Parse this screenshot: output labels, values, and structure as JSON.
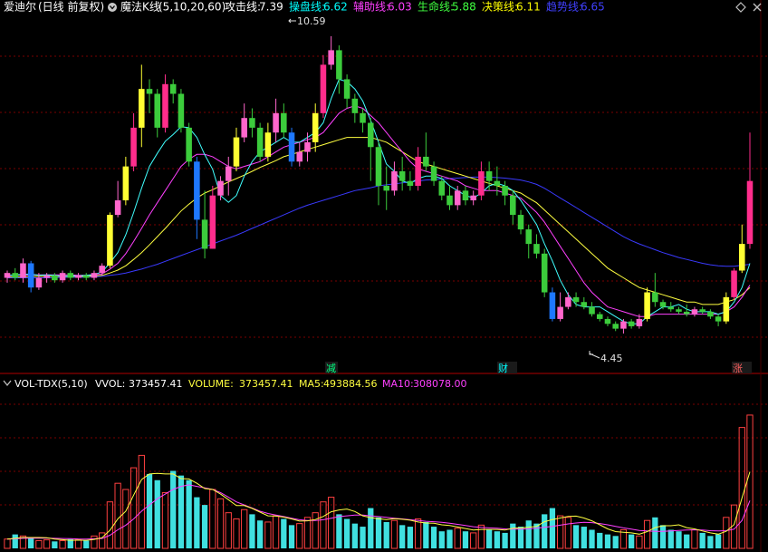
{
  "header": {
    "stock_name": "爱迪尔",
    "period_label": "(日线 前复权)",
    "indicator_name": "魔法K线",
    "indicator_params": "(5,10,20,60)",
    "lines": [
      {
        "label": "攻击线:",
        "value": "7.39",
        "color": "#ffffff"
      },
      {
        "label": "操盘线:",
        "value": "6.62",
        "color": "#00ffff"
      },
      {
        "label": "辅助线:",
        "value": "6.03",
        "color": "#ff40ff"
      },
      {
        "label": "生命线:",
        "value": "5.88",
        "color": "#40ff40"
      },
      {
        "label": "决策线:",
        "value": "6.11",
        "color": "#ffff00"
      },
      {
        "label": "趋势线:",
        "value": "6.65",
        "color": "#4040ff"
      }
    ],
    "corner_icons": [
      "diamond-icon",
      "close-icon"
    ]
  },
  "price_chart": {
    "high_label": "10.59",
    "low_label": "4.45",
    "signals": [
      {
        "text": "减",
        "color": "#00ff80"
      },
      {
        "text": "财",
        "color": "#00ffff"
      },
      {
        "text": "涨",
        "color": "#ff6060"
      }
    ],
    "colors": {
      "up_strong": "#ff2d8c",
      "up_yellow": "#ffff33",
      "down_green": "#3ccc3c",
      "down_blue": "#1e78ff",
      "up_pink": "#ff66cc"
    }
  },
  "volume_panel": {
    "indicator": "VOL-TDX(5,10)",
    "vvol_label": "VVOL:",
    "vvol_value": "373457.41",
    "volume_label": "VOLUME:",
    "volume_value": "373457.41",
    "ma5_label": "MA5:",
    "ma5_value": "493884.56",
    "ma10_label": "MA10:",
    "ma10_value": "308078.00",
    "colors": {
      "up": "#ff4040",
      "down": "#40e0e0",
      "ma5": "#ffff40",
      "ma10": "#ff40ff",
      "vvol": "#ffffff"
    }
  },
  "chart_data": {
    "type": "candlestick",
    "title": "爱迪尔 魔法K线",
    "ylim": [
      4.0,
      11.0
    ],
    "candles": [
      [
        5.6,
        5.7,
        5.5,
        5.75
      ],
      [
        5.7,
        5.6,
        5.55,
        5.8
      ],
      [
        5.6,
        5.9,
        5.5,
        6.0
      ],
      [
        5.9,
        5.4,
        5.3,
        5.95
      ],
      [
        5.4,
        5.6,
        5.35,
        5.7
      ],
      [
        5.6,
        5.65,
        5.5,
        5.7
      ],
      [
        5.65,
        5.55,
        5.5,
        5.7
      ],
      [
        5.55,
        5.7,
        5.5,
        5.75
      ],
      [
        5.7,
        5.6,
        5.55,
        5.75
      ],
      [
        5.6,
        5.65,
        5.55,
        5.7
      ],
      [
        5.65,
        5.6,
        5.55,
        5.7
      ],
      [
        5.6,
        5.7,
        5.55,
        5.75
      ],
      [
        5.7,
        5.85,
        5.65,
        5.9
      ],
      [
        5.85,
        6.9,
        5.8,
        6.95
      ],
      [
        6.9,
        7.2,
        6.85,
        7.6
      ],
      [
        7.2,
        7.9,
        7.1,
        8.1
      ],
      [
        7.9,
        8.7,
        7.8,
        9.0
      ],
      [
        8.7,
        9.5,
        8.3,
        10.0
      ],
      [
        9.5,
        9.4,
        9.0,
        9.7
      ],
      [
        9.4,
        8.7,
        8.5,
        9.5
      ],
      [
        8.7,
        9.6,
        8.6,
        9.8
      ],
      [
        9.6,
        9.4,
        9.2,
        9.7
      ],
      [
        9.4,
        8.7,
        8.6,
        9.5
      ],
      [
        8.7,
        8.0,
        7.9,
        8.8
      ],
      [
        8.0,
        6.8,
        6.4,
        8.1
      ],
      [
        6.8,
        6.2,
        6.0,
        7.4
      ],
      [
        6.2,
        7.3,
        6.2,
        7.5
      ],
      [
        7.3,
        7.6,
        7.2,
        7.7
      ],
      [
        7.6,
        7.9,
        7.3,
        8.1
      ],
      [
        7.9,
        8.5,
        7.8,
        8.7
      ],
      [
        8.5,
        8.9,
        8.4,
        9.2
      ],
      [
        8.9,
        8.7,
        8.5,
        9.1
      ],
      [
        8.7,
        8.1,
        8.0,
        8.8
      ],
      [
        8.1,
        8.6,
        8.0,
        8.8
      ],
      [
        8.6,
        9.0,
        8.4,
        9.3
      ],
      [
        9.0,
        8.6,
        8.5,
        9.2
      ],
      [
        8.6,
        8.0,
        7.9,
        8.7
      ],
      [
        8.0,
        8.2,
        7.9,
        8.4
      ],
      [
        8.2,
        8.4,
        8.0,
        8.6
      ],
      [
        8.4,
        9.0,
        8.2,
        9.2
      ],
      [
        9.0,
        10.0,
        8.9,
        10.2
      ],
      [
        10.0,
        10.3,
        9.9,
        10.59
      ],
      [
        10.3,
        9.7,
        9.4,
        10.4
      ],
      [
        9.7,
        9.3,
        9.1,
        9.8
      ],
      [
        9.3,
        9.0,
        8.8,
        9.4
      ],
      [
        9.0,
        8.8,
        8.6,
        9.1
      ],
      [
        8.8,
        8.3,
        7.6,
        8.9
      ],
      [
        8.3,
        7.5,
        7.1,
        8.4
      ],
      [
        7.5,
        7.4,
        7.0,
        7.9
      ],
      [
        7.4,
        7.8,
        7.3,
        8.0
      ],
      [
        7.8,
        7.6,
        7.4,
        8.1
      ],
      [
        7.6,
        7.5,
        7.4,
        7.8
      ],
      [
        7.5,
        8.1,
        7.4,
        8.3
      ],
      [
        8.1,
        7.9,
        7.8,
        8.6
      ],
      [
        7.9,
        7.6,
        7.5,
        8.0
      ],
      [
        7.6,
        7.3,
        7.2,
        7.7
      ],
      [
        7.3,
        7.1,
        7.0,
        7.5
      ],
      [
        7.1,
        7.4,
        7.0,
        7.5
      ],
      [
        7.4,
        7.2,
        7.1,
        7.5
      ],
      [
        7.2,
        7.3,
        7.1,
        7.4
      ],
      [
        7.3,
        7.8,
        7.2,
        8.0
      ],
      [
        7.8,
        7.6,
        7.4,
        8.0
      ],
      [
        7.6,
        7.5,
        7.3,
        7.9
      ],
      [
        7.5,
        7.3,
        7.1,
        7.6
      ],
      [
        7.3,
        6.9,
        6.7,
        7.4
      ],
      [
        6.9,
        6.6,
        6.5,
        7.0
      ],
      [
        6.6,
        6.3,
        6.0,
        6.7
      ],
      [
        6.3,
        6.1,
        6.0,
        6.5
      ],
      [
        6.1,
        5.3,
        5.2,
        6.2
      ],
      [
        5.3,
        4.75,
        4.7,
        5.4
      ],
      [
        4.75,
        5.0,
        4.7,
        5.3
      ],
      [
        5.0,
        5.2,
        4.95,
        5.3
      ],
      [
        5.2,
        5.1,
        5.0,
        5.3
      ],
      [
        5.1,
        5.0,
        4.95,
        5.2
      ],
      [
        5.0,
        4.85,
        4.8,
        5.1
      ],
      [
        4.85,
        4.75,
        4.7,
        4.9
      ],
      [
        4.75,
        4.65,
        4.6,
        4.8
      ],
      [
        4.65,
        4.55,
        4.5,
        4.7
      ],
      [
        4.55,
        4.7,
        4.45,
        4.75
      ],
      [
        4.7,
        4.6,
        4.55,
        4.75
      ],
      [
        4.6,
        4.75,
        4.55,
        4.85
      ],
      [
        4.75,
        5.3,
        4.7,
        5.4
      ],
      [
        5.3,
        5.1,
        5.0,
        5.7
      ],
      [
        5.1,
        5.0,
        4.95,
        5.15
      ],
      [
        5.0,
        4.95,
        4.9,
        5.1
      ],
      [
        4.95,
        4.9,
        4.85,
        5.0
      ],
      [
        4.9,
        4.85,
        4.8,
        5.05
      ],
      [
        4.85,
        4.95,
        4.8,
        5.0
      ],
      [
        4.95,
        4.9,
        4.85,
        5.0
      ],
      [
        4.9,
        4.8,
        4.75,
        4.95
      ],
      [
        4.8,
        4.7,
        4.6,
        4.85
      ],
      [
        4.7,
        5.2,
        4.65,
        5.3
      ],
      [
        5.2,
        5.75,
        5.15,
        5.8
      ],
      [
        5.75,
        6.3,
        5.7,
        6.7
      ],
      [
        6.3,
        7.6,
        6.2,
        8.6
      ]
    ],
    "ma5": [
      5.65,
      5.66,
      5.67,
      5.68,
      5.65,
      5.66,
      5.65,
      5.63,
      5.64,
      5.64,
      5.65,
      5.67,
      5.72,
      5.91,
      6.12,
      6.49,
      6.95,
      7.45,
      7.9,
      8.17,
      8.42,
      8.56,
      8.72,
      8.7,
      8.5,
      8.14,
      7.84,
      7.3,
      7.16,
      7.3,
      7.7,
      8.0,
      8.2,
      8.3,
      8.4,
      8.5,
      8.4,
      8.4,
      8.5,
      8.6,
      8.8,
      9.3,
      9.7,
      9.65,
      9.5,
      9.25,
      8.85,
      8.4,
      7.95,
      7.8,
      7.6,
      7.55,
      7.65,
      7.7,
      7.7,
      7.65,
      7.5,
      7.4,
      7.3,
      7.25,
      7.35,
      7.5,
      7.55,
      7.5,
      7.4,
      7.2,
      6.95,
      6.7,
      6.3,
      5.95,
      5.55,
      5.25,
      5.05,
      5.0,
      5.0,
      5.0,
      4.9,
      4.8,
      4.7,
      4.65,
      4.65,
      4.8,
      4.9,
      5.0,
      5.0,
      5.05,
      4.95,
      4.9,
      4.9,
      4.9,
      4.85,
      4.9,
      5.1,
      5.4,
      5.9
    ],
    "ma10": [
      5.65,
      5.65,
      5.66,
      5.66,
      5.66,
      5.66,
      5.66,
      5.66,
      5.66,
      5.65,
      5.65,
      5.66,
      5.68,
      5.78,
      5.9,
      6.1,
      6.35,
      6.62,
      6.9,
      7.15,
      7.4,
      7.65,
      7.9,
      8.05,
      8.15,
      8.15,
      8.1,
      8.0,
      7.9,
      7.85,
      7.9,
      7.95,
      8.0,
      8.1,
      8.2,
      8.3,
      8.35,
      8.4,
      8.45,
      8.5,
      8.6,
      8.8,
      9.0,
      9.1,
      9.15,
      9.1,
      8.95,
      8.8,
      8.6,
      8.4,
      8.2,
      8.0,
      7.85,
      7.8,
      7.75,
      7.7,
      7.65,
      7.6,
      7.5,
      7.45,
      7.4,
      7.4,
      7.4,
      7.35,
      7.3,
      7.25,
      7.1,
      6.95,
      6.75,
      6.5,
      6.25,
      6.0,
      5.75,
      5.5,
      5.3,
      5.15,
      5.0,
      4.95,
      4.9,
      4.85,
      4.8,
      4.8,
      4.85,
      4.85,
      4.85,
      4.85,
      4.85,
      4.85,
      4.85,
      4.85,
      4.85,
      4.9,
      5.0,
      5.2,
      5.45
    ],
    "ma20": [
      5.62,
      5.62,
      5.62,
      5.63,
      5.63,
      5.63,
      5.63,
      5.63,
      5.63,
      5.63,
      5.63,
      5.64,
      5.65,
      5.7,
      5.76,
      5.85,
      5.98,
      6.12,
      6.28,
      6.45,
      6.62,
      6.8,
      6.98,
      7.12,
      7.25,
      7.35,
      7.42,
      7.5,
      7.58,
      7.65,
      7.72,
      7.8,
      7.88,
      7.95,
      8.02,
      8.1,
      8.15,
      8.2,
      8.25,
      8.3,
      8.35,
      8.4,
      8.45,
      8.5,
      8.5,
      8.5,
      8.5,
      8.45,
      8.4,
      8.3,
      8.2,
      8.1,
      8.0,
      7.95,
      7.9,
      7.85,
      7.8,
      7.75,
      7.7,
      7.65,
      7.6,
      7.55,
      7.5,
      7.45,
      7.4,
      7.35,
      7.25,
      7.15,
      7.0,
      6.85,
      6.7,
      6.55,
      6.4,
      6.25,
      6.1,
      5.95,
      5.8,
      5.7,
      5.6,
      5.5,
      5.4,
      5.35,
      5.3,
      5.25,
      5.2,
      5.15,
      5.1,
      5.1,
      5.05,
      5.05,
      5.05,
      5.1,
      5.15,
      5.25,
      5.4
    ],
    "ma60": [
      5.6,
      5.6,
      5.6,
      5.6,
      5.6,
      5.6,
      5.6,
      5.61,
      5.61,
      5.61,
      5.61,
      5.62,
      5.63,
      5.65,
      5.67,
      5.7,
      5.74,
      5.78,
      5.83,
      5.88,
      5.94,
      6.0,
      6.06,
      6.12,
      6.18,
      6.24,
      6.3,
      6.36,
      6.42,
      6.48,
      6.55,
      6.62,
      6.69,
      6.76,
      6.83,
      6.9,
      6.97,
      7.04,
      7.1,
      7.15,
      7.2,
      7.25,
      7.3,
      7.35,
      7.4,
      7.43,
      7.46,
      7.5,
      7.52,
      7.54,
      7.56,
      7.58,
      7.6,
      7.62,
      7.63,
      7.64,
      7.65,
      7.66,
      7.67,
      7.68,
      7.68,
      7.68,
      7.67,
      7.66,
      7.64,
      7.62,
      7.58,
      7.53,
      7.45,
      7.35,
      7.25,
      7.15,
      7.05,
      6.95,
      6.85,
      6.75,
      6.65,
      6.55,
      6.45,
      6.37,
      6.3,
      6.24,
      6.18,
      6.12,
      6.07,
      6.02,
      5.98,
      5.94,
      5.9,
      5.87,
      5.85,
      5.84,
      5.84,
      5.86,
      5.88
    ],
    "volume": {
      "ylim": [
        0,
        1000000
      ],
      "values": [
        60000,
        90000,
        80000,
        70000,
        50000,
        55000,
        45000,
        50000,
        60000,
        55000,
        50000,
        80000,
        100000,
        300000,
        420000,
        380000,
        520000,
        600000,
        480000,
        440000,
        360000,
        500000,
        470000,
        440000,
        330000,
        280000,
        380000,
        320000,
        230000,
        190000,
        250000,
        220000,
        180000,
        170000,
        210000,
        190000,
        150000,
        160000,
        200000,
        230000,
        300000,
        330000,
        220000,
        190000,
        160000,
        140000,
        260000,
        200000,
        170000,
        180000,
        150000,
        140000,
        190000,
        170000,
        140000,
        110000,
        120000,
        130000,
        110000,
        100000,
        150000,
        120000,
        110000,
        100000,
        160000,
        140000,
        180000,
        160000,
        220000,
        260000,
        210000,
        200000,
        150000,
        140000,
        120000,
        100000,
        90000,
        80000,
        120000,
        90000,
        80000,
        180000,
        200000,
        150000,
        120000,
        110000,
        90000,
        120000,
        100000,
        80000,
        90000,
        200000,
        280000,
        780000,
        860000
      ],
      "ma5": [
        60000,
        65000,
        70000,
        70000,
        70000,
        69000,
        60000,
        56000,
        52000,
        53000,
        52000,
        58000,
        69000,
        117000,
        190000,
        240000,
        344000,
        444000,
        480000,
        484000,
        480000,
        480000,
        450000,
        448000,
        420000,
        386000,
        380000,
        350000,
        314000,
        276000,
        276000,
        258000,
        234000,
        210000,
        208000,
        202000,
        190000,
        176000,
        178000,
        186000,
        206000,
        236000,
        248000,
        254000,
        238000,
        210000,
        198000,
        192000,
        186000,
        192000,
        188000,
        182000,
        170000,
        164000,
        162000,
        152000,
        148000,
        138000,
        128000,
        118000,
        122000,
        122000,
        122000,
        118000,
        130000,
        132000,
        136000,
        142000,
        172000,
        186000,
        196000,
        206000,
        208000,
        196000,
        178000,
        152000,
        126000,
        108000,
        104000,
        100000,
        92000,
        108000,
        134000,
        146000,
        146000,
        152000,
        134000,
        126000,
        112000,
        100000,
        92000,
        110000,
        154000,
        326000,
        493884
      ],
      "ma10": [
        60000,
        62000,
        65000,
        66000,
        66000,
        66000,
        65000,
        64000,
        63000,
        61000,
        60000,
        62000,
        64000,
        85000,
        120000,
        150000,
        190000,
        240000,
        280000,
        320000,
        350000,
        380000,
        400000,
        410000,
        400000,
        390000,
        380000,
        360000,
        330000,
        300000,
        280000,
        260000,
        240000,
        225000,
        215000,
        205000,
        195000,
        185000,
        180000,
        180000,
        185000,
        195000,
        205000,
        210000,
        215000,
        215000,
        210000,
        205000,
        200000,
        195000,
        190000,
        185000,
        180000,
        175000,
        172000,
        168000,
        162000,
        155000,
        148000,
        140000,
        135000,
        132000,
        130000,
        126000,
        124000,
        124000,
        126000,
        130000,
        136000,
        142000,
        150000,
        158000,
        164000,
        168000,
        166000,
        160000,
        152000,
        142000,
        132000,
        124000,
        116000,
        112000,
        110000,
        110000,
        112000,
        116000,
        118000,
        120000,
        118000,
        114000,
        112000,
        114000,
        124000,
        180000,
        308078
      ]
    }
  }
}
